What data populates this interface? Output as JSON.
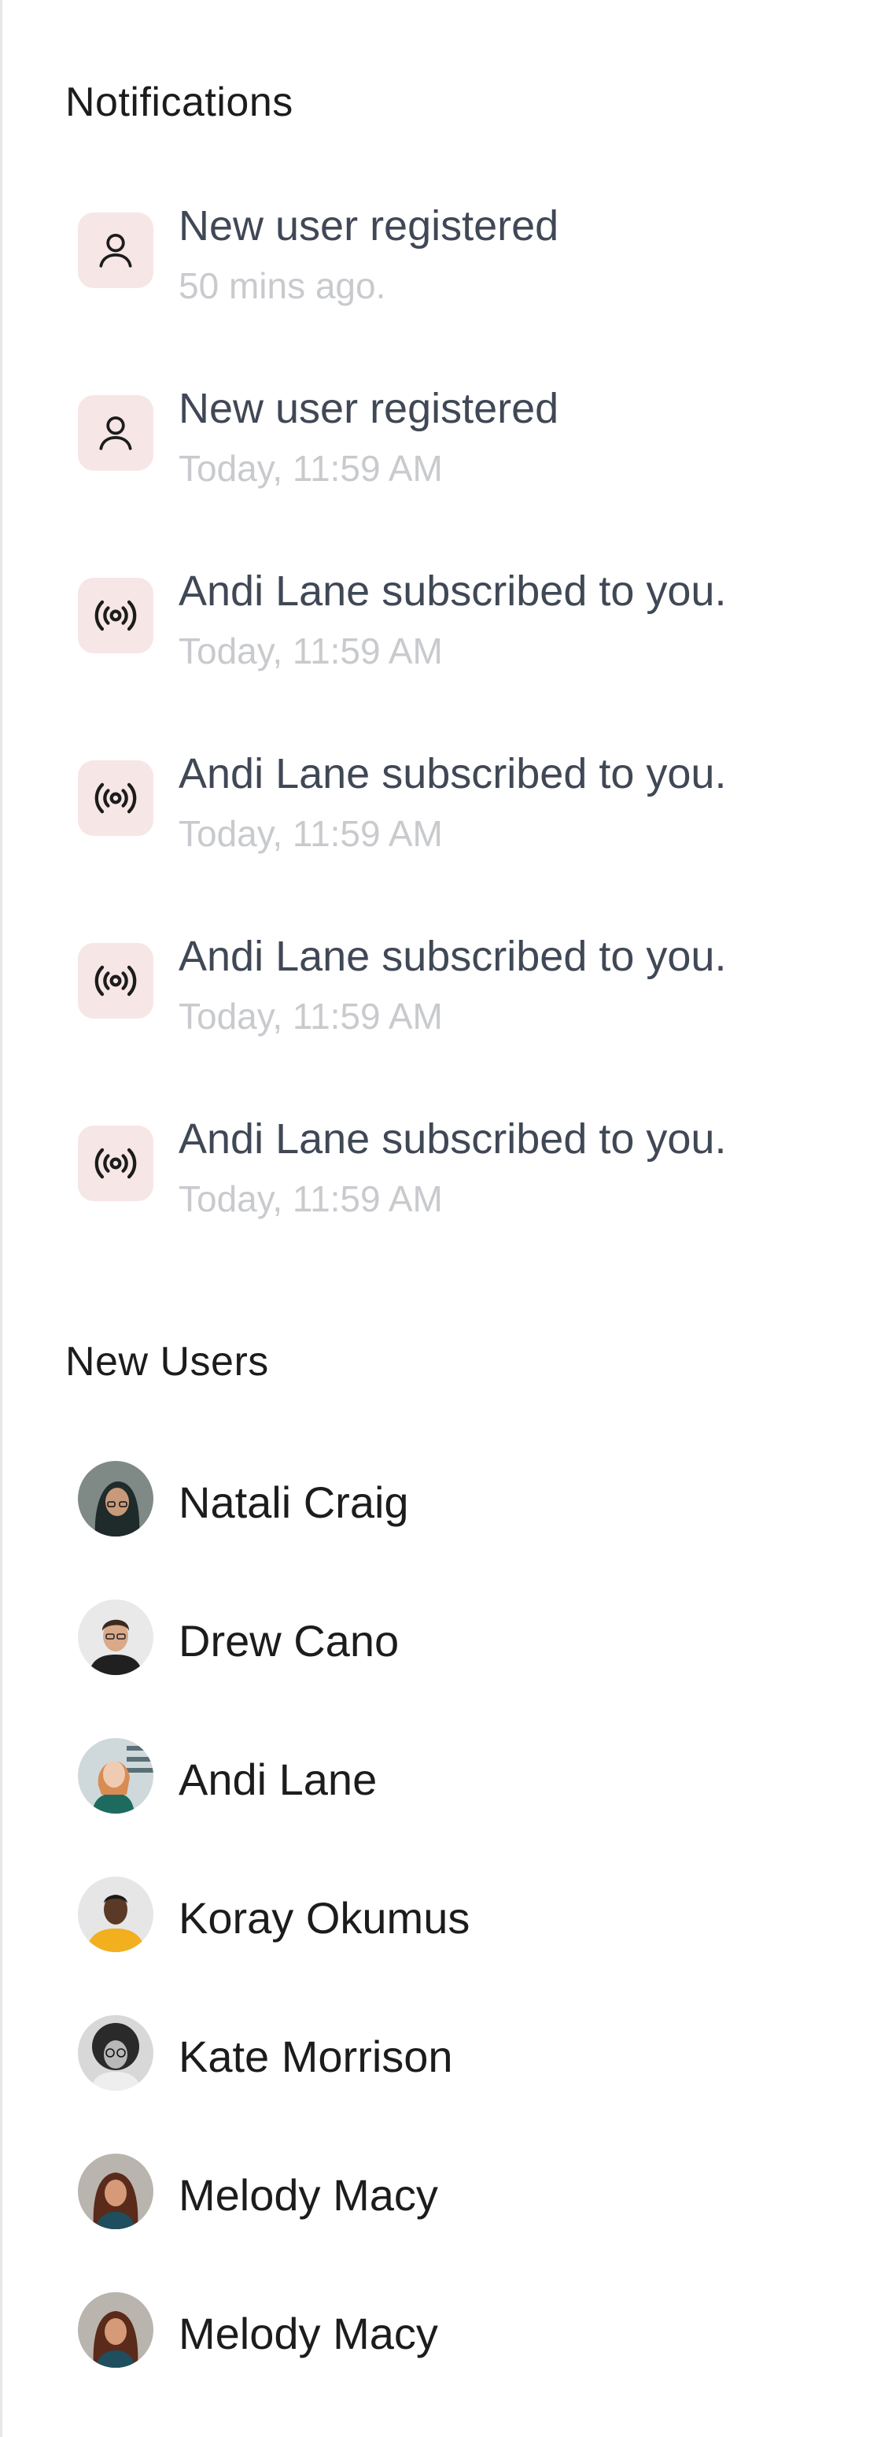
{
  "notifications": {
    "title": "Notifications",
    "items": [
      {
        "icon": "user-icon",
        "title": "New user registered",
        "time": "50 mins  ago."
      },
      {
        "icon": "user-icon",
        "title": "New user registered",
        "time": "Today, 11:59 AM"
      },
      {
        "icon": "broadcast-icon",
        "title": "Andi Lane subscribed to you.",
        "time": "Today, 11:59 AM"
      },
      {
        "icon": "broadcast-icon",
        "title": "Andi Lane subscribed to you.",
        "time": "Today, 11:59 AM"
      },
      {
        "icon": "broadcast-icon",
        "title": "Andi Lane subscribed to you.",
        "time": "Today, 11:59 AM"
      },
      {
        "icon": "broadcast-icon",
        "title": "Andi Lane subscribed to you.",
        "time": "Today, 11:59 AM"
      }
    ]
  },
  "new_users": {
    "title": "New Users",
    "items": [
      {
        "name": "Natali Craig"
      },
      {
        "name": "Drew Cano"
      },
      {
        "name": "Andi Lane"
      },
      {
        "name": "Koray Okumus"
      },
      {
        "name": "Kate Morrison"
      },
      {
        "name": "Melody Macy"
      },
      {
        "name": "Melody Macy"
      }
    ]
  },
  "colors": {
    "icon_bg": "#f7e6e6",
    "title_text": "#404856",
    "time_text": "#c8cacd",
    "heading_text": "#1c1c1c"
  }
}
